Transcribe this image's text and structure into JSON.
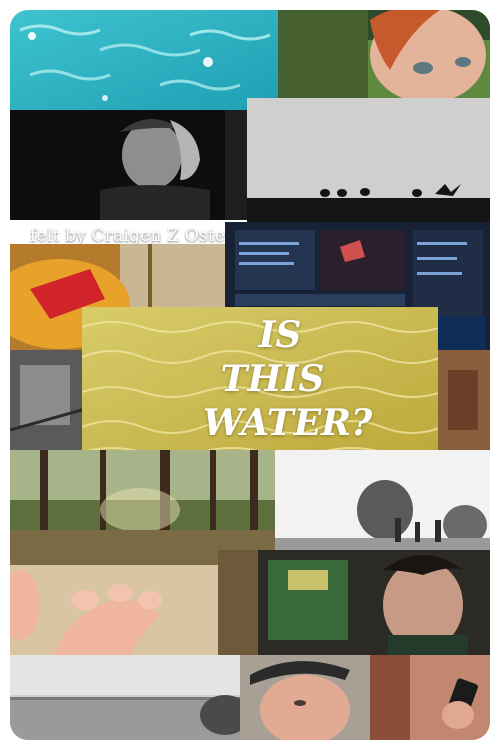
{
  "poster": {
    "credit_line": "felt by Craigen Z Oster",
    "title_lines": [
      "IS",
      "THIS",
      "WATER?"
    ]
  },
  "colors": {
    "water_turquoise": "#2eb6c4",
    "title_gold": "#c8b84a",
    "title_text": "#ffffff"
  },
  "tiles": [
    "turquoise-water-photo",
    "red-haired-person-photo",
    "man-head-in-hand-photo",
    "birds-on-wall-photo",
    "orange-cymbal-photo",
    "video-editor-screen-photo",
    "golden-water-title-photo",
    "forest-sunlight-photo",
    "people-under-trees-photo",
    "hand-in-sand-photo",
    "man-in-workshop-photo",
    "sea-horizon-photo",
    "man-with-cap-photo",
    "hand-holding-phone-photo"
  ]
}
